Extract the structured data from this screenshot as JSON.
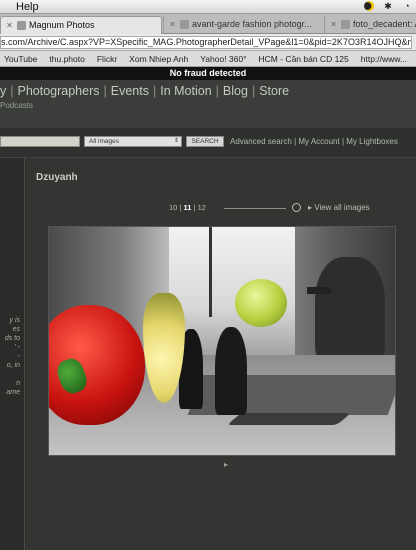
{
  "os": {
    "help_menu": "Help"
  },
  "tabs": [
    {
      "label": "Magnum Photos",
      "active": true
    },
    {
      "label": "avant-garde fashion photogr...",
      "active": false
    },
    {
      "label": "foto_decadent: Alice",
      "active": false
    }
  ],
  "url": "s.com/Archive/C.aspx?VP=XSpecific_MAG.PhotographerDetail_VPage&l1=0&pid=2K7O3R14OJHQ&nm",
  "bookmarks": [
    "YouTube",
    "thu.photo",
    "Flickr",
    "Xom Nhiep Anh",
    "Yahoo! 360°",
    "HCM - Cần bán CD 125",
    "http://www..."
  ],
  "fraud_banner": "No fraud detected",
  "site_nav": {
    "items": [
      "y",
      "Photographers",
      "Events",
      "In Motion",
      "Blog",
      "Store"
    ],
    "separator": "|",
    "sub": "Podcasts"
  },
  "search": {
    "select_value": "All images",
    "button": "SEARCH",
    "advanced": "Advanced search",
    "account": "My Account",
    "lightboxes": "My Lightboxes",
    "link_sep": "|"
  },
  "left_blurb": {
    "lines": [
      "y is",
      "es",
      "ds to",
      "' -",
      "-",
      "o, in",
      "",
      "n",
      "ame"
    ]
  },
  "content": {
    "photographer": "Dzuyanh",
    "pager": {
      "prev": "10",
      "current": "11",
      "next": "12",
      "sep": "|"
    },
    "view_all": "View all images"
  },
  "icons": {
    "view_all_icon": "play-triangle",
    "clock_icon": "clock",
    "next_icon": "caret-right"
  }
}
